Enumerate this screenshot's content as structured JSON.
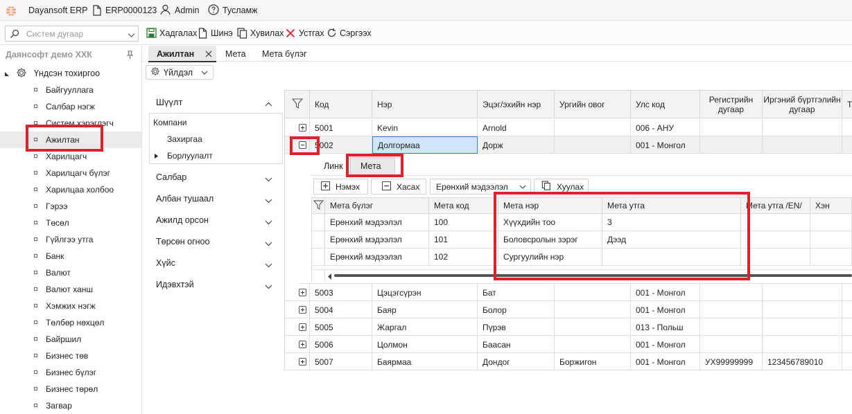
{
  "app": {
    "title": "Dayansoft ERP",
    "code": "ERP0000123",
    "user": "Admin",
    "help": "Тусламж"
  },
  "search": {
    "placeholder": "Систем дугаар"
  },
  "toolbar": {
    "save": "Хадгалах",
    "new": "Шинэ",
    "copy": "Хувилах",
    "delete": "Устгах",
    "refresh": "Сэргээх"
  },
  "sidebar": {
    "company": "Даянсофт демо ХХК",
    "root": "Үндсэн тохиргоо",
    "items": [
      "Байгууллага",
      "Салбар нэгж",
      "Систем хэрэглэгч",
      "Ажилтан",
      "Харилцагч",
      "Харилцагч бүлэг",
      "Харилцаа холбоо",
      "Гэрээ",
      "Төсөл",
      "Гүйлгээ утга",
      "Банк",
      "Валют",
      "Валют ханш",
      "Хэмжих нэгж",
      "Төлбөр нөхцөл",
      "Байршил",
      "Бизнес төв",
      "Бизнес бүлэг",
      "Бизнес төрөл",
      "Загвар"
    ]
  },
  "tabs": [
    "Ажилтан",
    "Мета",
    "Мета бүлэг"
  ],
  "action_button": "Үйлдэл",
  "filter": {
    "title": "Шүүлт",
    "company_label": "Компани",
    "sub": [
      "Захиргаа",
      "Борлуулалт"
    ],
    "sections": [
      "Салбар",
      "Албан тушаал",
      "Ажилд орсон",
      "Төрсөн огноо",
      "Хүйс",
      "Идэвхтэй"
    ]
  },
  "grid": {
    "headers": [
      "Код",
      "Нэр",
      "Эцэг/эхийн нэр",
      "Ургийн овог",
      "Улс код",
      "Регистрийн дугаар",
      "Иргэний бүртгэлийн дугаар",
      "Та"
    ],
    "rows_top": [
      {
        "code": "5001",
        "name": "Kevin",
        "father": "Arnold",
        "clan": "",
        "country": "006 - АНУ",
        "reg": "",
        "civ": ""
      },
      {
        "code": "5002",
        "name": "Долгормаа",
        "father": "Дорж",
        "clan": "",
        "country": "001 - Монгол",
        "reg": "",
        "civ": ""
      }
    ],
    "rows_bottom": [
      {
        "code": "5003",
        "name": "Цэцэгсүрэн",
        "father": "Бат",
        "clan": "",
        "country": "001 - Монгол",
        "reg": "",
        "civ": ""
      },
      {
        "code": "5004",
        "name": "Баяр",
        "father": "Болор",
        "clan": "",
        "country": "001 - Монгол",
        "reg": "",
        "civ": ""
      },
      {
        "code": "5005",
        "name": "Жаргал",
        "father": "Пүрэв",
        "clan": "",
        "country": "013 - Польш",
        "reg": "",
        "civ": ""
      },
      {
        "code": "5006",
        "name": "Цолмон",
        "father": "Баасан",
        "clan": "",
        "country": "001 - Монгол",
        "reg": "",
        "civ": ""
      },
      {
        "code": "5007",
        "name": "Баярмаа",
        "father": "Дондог",
        "clan": "Боржигон",
        "country": "001 - Монгол",
        "reg": "УХ99999999",
        "civ": "123456789010"
      }
    ]
  },
  "detail": {
    "tabs": [
      "Линк",
      "Мета"
    ],
    "add": "Нэмэх",
    "remove": "Хасах",
    "group_select": "Ерөнхий мэдээлэл",
    "copy": "Хуулах",
    "headers": [
      "Мета бүлэг",
      "Мета код",
      "Мета нэр",
      "Мета утга",
      "Мета утга /EN/",
      "Хэн"
    ],
    "rows": [
      {
        "group": "Ерөнхий мэдээлэл",
        "code": "100",
        "name": "Хүүхдийн тоо",
        "value": "3"
      },
      {
        "group": "Ерөнхий мэдээлэл",
        "code": "101",
        "name": "Боловсролын зэрэг",
        "value": "Дээд"
      },
      {
        "group": "Ерөнхий мэдээлэл",
        "code": "102",
        "name": "Сургуулийн нэр",
        "value": ""
      }
    ]
  },
  "colors": {
    "accent": "#e0202a",
    "selected": "#cfe6fb",
    "tab_active": "#e8e8e8"
  }
}
